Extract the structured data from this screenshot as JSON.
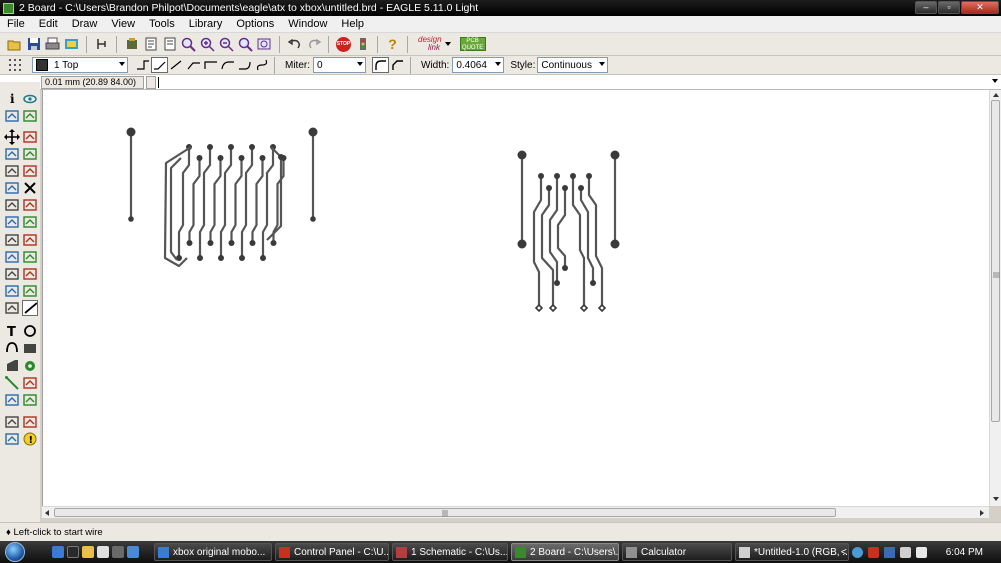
{
  "window": {
    "title": "2 Board - C:\\Users\\Brandon Philpot\\Documents\\eagle\\atx to xbox\\untitled.brd - EAGLE 5.11.0 Light",
    "controls": {
      "minimize": "–",
      "maximize": "▫",
      "close": "✕"
    }
  },
  "menu": [
    "File",
    "Edit",
    "Draw",
    "View",
    "Tools",
    "Library",
    "Options",
    "Window",
    "Help"
  ],
  "toolbar": {
    "icons": [
      "open-icon",
      "save-icon",
      "print-icon",
      "cam-icon",
      "schematic-icon",
      "ulp-icon",
      "script-icon",
      "zoom-fit-icon",
      "zoom-in-icon",
      "zoom-out-icon",
      "zoom-redraw-icon",
      "zoom-select-icon",
      "undo-icon",
      "redo-icon",
      "stop-icon",
      "go-icon",
      "help-icon"
    ],
    "stop_label": "STOP",
    "help_label": "?",
    "designlink": {
      "line1": "design",
      "line2": "link"
    },
    "pcb_quote": {
      "line1": "PCB",
      "line2": "QUOTE"
    }
  },
  "params": {
    "layer": "1 Top",
    "layer_color": "#333333",
    "miter_label": "Miter:",
    "miter_value": "0",
    "width_label": "Width:",
    "width_value": "0.4064",
    "style_label": "Style:",
    "style_value": "Continuous"
  },
  "command": {
    "coordinates": "0.01 mm (20.89 84.00)",
    "value": ""
  },
  "palette": [
    "info-icon",
    "show-icon",
    "display-icon",
    "mark-icon",
    "move-icon",
    "copy-icon",
    "mirror-icon",
    "rotate-icon",
    "group-icon",
    "change-icon",
    "paste-icon",
    "delete-icon",
    "add-icon",
    "pinswap-icon",
    "gateswap-icon",
    "replace-icon",
    "lock-icon",
    "smash-icon",
    "name-icon",
    "value-icon",
    "split-icon",
    "miter-icon",
    "optimize-icon",
    "route-icon",
    "ripup-icon",
    "wire-icon",
    "text-icon",
    "circle-icon",
    "arc-icon",
    "rect-icon",
    "polygon-icon",
    "via-icon",
    "signal-icon",
    "hole-icon",
    "attribute-icon",
    "ratsnest-icon",
    "autoroute-icon",
    "erc-icon",
    "drc-icon",
    "errors-icon"
  ],
  "status": "Left-click to start wire",
  "taskbar": {
    "tasks": [
      {
        "label": "xbox original mobo...",
        "icon": "ie-icon",
        "color": "#3c7bd4"
      },
      {
        "label": "Control Panel - C:\\U...",
        "icon": "control-panel-icon",
        "color": "#c83020"
      },
      {
        "label": "1 Schematic - C:\\Us...",
        "icon": "schematic-icon",
        "color": "#b04040"
      },
      {
        "label": "2 Board - C:\\Users\\...",
        "icon": "board-icon",
        "color": "#3a8a2c"
      },
      {
        "label": "Calculator",
        "icon": "calculator-icon",
        "color": "#909090"
      },
      {
        "label": "*Untitled-1.0 (RGB, ...",
        "icon": "image-editor-icon",
        "color": "#d0d0d0"
      }
    ],
    "tray_chevron": "<",
    "clock": "6:04 PM"
  },
  "colors": {
    "trace": "#555555",
    "pad": "#3a3a3a",
    "canvas": "#ffffff"
  }
}
